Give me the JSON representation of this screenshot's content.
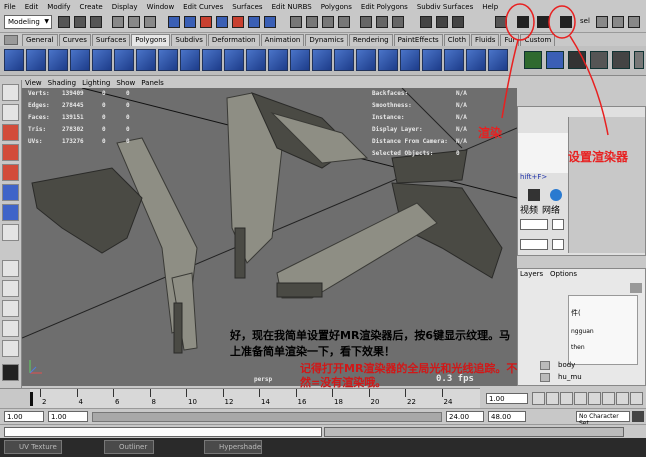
{
  "menubar": [
    "File",
    "Edit",
    "Modify",
    "Create",
    "Display",
    "Window",
    "Edit Curves",
    "Surfaces",
    "Edit NURBS",
    "Polygons",
    "Edit Polygons",
    "Subdiv Surfaces",
    "Help"
  ],
  "status": {
    "mode": "Modeling",
    "sel_label": "sel"
  },
  "shelf_tabs": [
    "General",
    "Curves",
    "Surfaces",
    "Polygons",
    "Subdivs",
    "Deformation",
    "Animation",
    "Dynamics",
    "Rendering",
    "PaintEffects",
    "Cloth",
    "Fluids",
    "Fur",
    "Custom"
  ],
  "active_tab": "Polygons",
  "panel_menu": [
    "View",
    "Shading",
    "Lighting",
    "Show",
    "Panels"
  ],
  "hud_left": [
    {
      "label": "Verts:",
      "v1": "139409",
      "v2": "0",
      "v3": "0"
    },
    {
      "label": "Edges:",
      "v1": "278445",
      "v2": "0",
      "v3": "0"
    },
    {
      "label": "Faces:",
      "v1": "139151",
      "v2": "0",
      "v3": "0"
    },
    {
      "label": "Tris:",
      "v1": "278302",
      "v2": "0",
      "v3": "0"
    },
    {
      "label": "UVs:",
      "v1": "173276",
      "v2": "0",
      "v3": "0"
    }
  ],
  "hud_right": [
    {
      "label": "Backfaces:",
      "value": "N/A"
    },
    {
      "label": "Smoothness:",
      "value": "N/A"
    },
    {
      "label": "Instance:",
      "value": "N/A"
    },
    {
      "label": "Display Layer:",
      "value": "N/A"
    },
    {
      "label": "Distance From Camera:",
      "value": "N/A"
    },
    {
      "label": "Selected Objects:",
      "value": "0"
    }
  ],
  "camera_label": "persp",
  "fps_label": "0.3 fps",
  "caption_black": "好，现在我简单设置好MR渲染器后，按6键显示纹理。马上准备简单渲染一下，看下效果！",
  "caption_red": "记得打开MR渲染器的全局光和光线追踪。不然=没有渲染哦。",
  "annot_render": "渲染",
  "annot_settings": "设置渲染器",
  "right_panel": {
    "shift_hint": "hift+F>",
    "video": "视频",
    "network": "网络",
    "layers_tab": "Layers",
    "options_tab": "Options",
    "file_hint": "件(",
    "users": [
      "ngguan",
      "then"
    ],
    "layer_rows": [
      "body",
      "hu_mu"
    ]
  },
  "timeline_ticks": [
    "2",
    "4",
    "6",
    "8",
    "10",
    "12",
    "14",
    "16",
    "18",
    "20",
    "22",
    "24"
  ],
  "current_frame": "1.00",
  "range": {
    "start1": "1.00",
    "start2": "1.00",
    "end1": "24.00",
    "end2": "48.00",
    "charset": "No Character Set"
  },
  "taskbar": [
    "UV Texture",
    "Outliner",
    "Hypershade"
  ],
  "colors": {
    "annotation": "#e82020",
    "caption_red": "#d01818",
    "viewport_bg": "#6e6e6e"
  }
}
